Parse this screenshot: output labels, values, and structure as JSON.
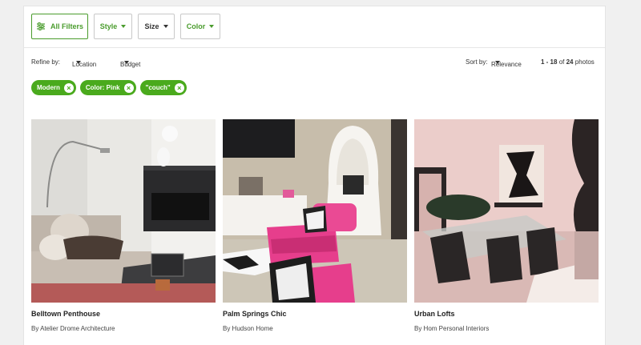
{
  "filters": {
    "all_filters_label": "All Filters",
    "style_label": "Style",
    "size_label": "Size",
    "color_label": "Color"
  },
  "refine": {
    "refine_by_label": "Refine by:",
    "location_label": "Location",
    "budget_label": "Budget",
    "sort_by_label": "Sort by:",
    "sort_value": "Relevance",
    "results_range": "1 - 18",
    "results_of": "of",
    "results_total": "24",
    "results_unit": "photos"
  },
  "chips": [
    {
      "label": "Modern"
    },
    {
      "label": "Color: Pink"
    },
    {
      "label": "\"couch\""
    }
  ],
  "cards": [
    {
      "title": "Belltown Penthouse",
      "byline": "By Atelier Drome Architecture"
    },
    {
      "title": "Palm Springs Chic",
      "byline": "By Hudson Home"
    },
    {
      "title": "Urban Lofts",
      "byline": "By Hom Personal Interiors"
    }
  ],
  "colors": {
    "accent": "#4aaa1d",
    "accent_text": "#4a9c2d"
  }
}
